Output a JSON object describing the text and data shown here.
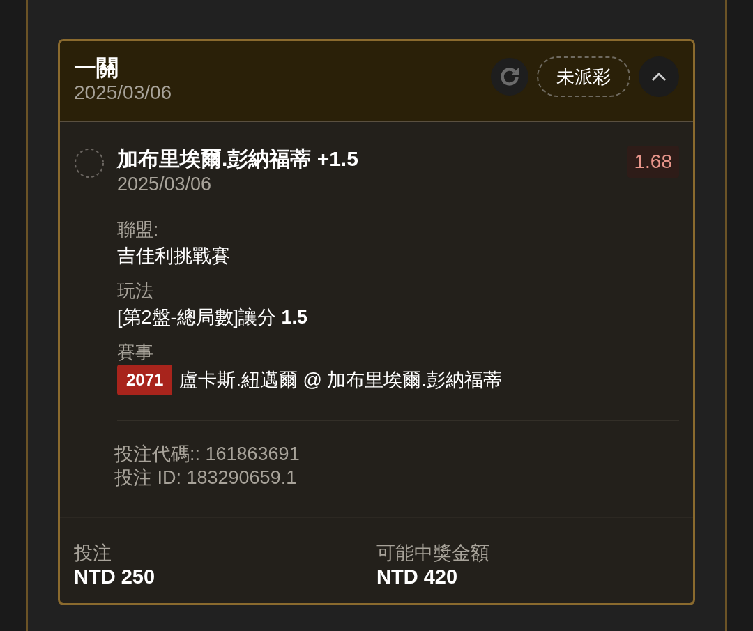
{
  "bet": {
    "title": "一關",
    "date": "2025/03/06",
    "status": "未派彩",
    "expanded": true
  },
  "leg": {
    "selection": "加布里埃爾.彭納福蒂 +1.5",
    "date": "2025/03/06",
    "odds": "1.68",
    "fields": [
      {
        "label": "聯盟:",
        "value": "吉佳利挑戰賽"
      },
      {
        "label": "玩法",
        "value": "[第2盤-總局數]讓分 **1.5**"
      },
      {
        "label": "賽事",
        "badge": "2071",
        "value": "盧卡斯.紐邁爾 @ 加布里埃爾.彭納福蒂"
      }
    ],
    "codes": [
      "投注代碼:: 161863691",
      "投注 ID: 183290659.1"
    ]
  },
  "footer": [
    {
      "label": "投注",
      "value": "NTD 250"
    },
    {
      "label": "可能中獎金額",
      "value": "NTD 420"
    }
  ]
}
